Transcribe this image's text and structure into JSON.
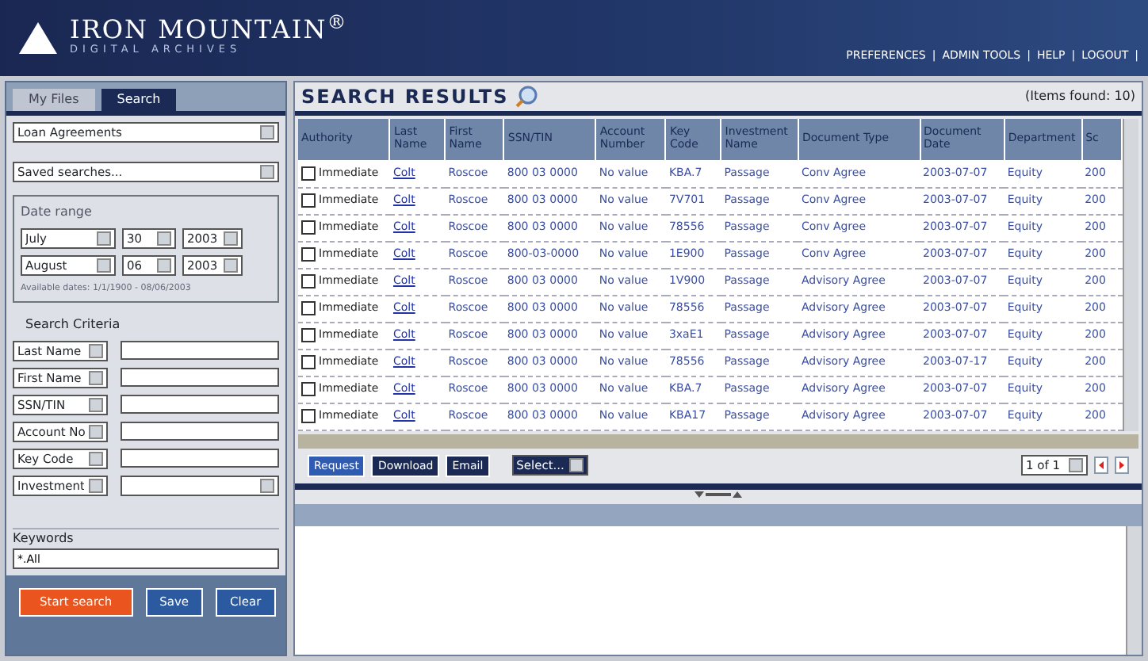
{
  "header": {
    "logo_name": "IRON MOUNTAIN",
    "logo_mark": "®",
    "logo_sub": "DIGITAL ARCHIVES",
    "links": [
      "PREFERENCES",
      "ADMIN TOOLS",
      "HELP",
      "LOGOUT"
    ],
    "separator": "|"
  },
  "sidebar": {
    "tabs": [
      {
        "label": "My Files",
        "selected": false
      },
      {
        "label": "Search",
        "selected": true
      }
    ],
    "category": "Loan Agreements",
    "saved_searches": "Saved searches...",
    "date_range": {
      "legend": "Date range",
      "from": [
        "July",
        "30",
        "2003"
      ],
      "to": [
        "August",
        "06",
        "2003"
      ],
      "note": "Available dates: 1/1/1900 - 08/06/2003"
    },
    "criteria_title": "Search Criteria",
    "criteria": [
      {
        "field": "Last Name",
        "kind": "text"
      },
      {
        "field": "First Name",
        "kind": "text"
      },
      {
        "field": "SSN/TIN",
        "kind": "text"
      },
      {
        "field": "Account No",
        "kind": "text"
      },
      {
        "field": "Key Code",
        "kind": "text"
      },
      {
        "field": "Investment",
        "kind": "select"
      }
    ],
    "keywords_label": "Keywords",
    "keywords": "*.All",
    "buttons": [
      {
        "label": "Start search",
        "kind": "primary"
      },
      {
        "label": "Save",
        "kind": "secondary"
      },
      {
        "label": "Clear",
        "kind": "secondary"
      }
    ]
  },
  "results": {
    "title": "SEARCH RESULTS",
    "count": "(Items found: 10)",
    "columns": [
      "Authority",
      "Last Name",
      "First Name",
      "SSN/TIN",
      "Account Number",
      "Key Code",
      "Investment Name",
      "Document Type",
      "Document Date",
      "Department",
      "Sc"
    ],
    "rows": [
      {
        "checked": false,
        "cells": [
          "Immediate",
          "Colt",
          "Roscoe",
          "800 03 0000",
          "No value",
          "KBA.7",
          "Passage",
          "Conv Agree",
          "2003-07-07",
          "Equity",
          "200"
        ]
      },
      {
        "checked": false,
        "cells": [
          "Immediate",
          "Colt",
          "Roscoe",
          "800 03 0000",
          "No value",
          "7V701",
          "Passage",
          "Conv Agree",
          "2003-07-07",
          "Equity",
          "200"
        ]
      },
      {
        "checked": false,
        "cells": [
          "Immediate",
          "Colt",
          "Roscoe",
          "800 03 0000",
          "No value",
          "78556",
          "Passage",
          "Conv Agree",
          "2003-07-07",
          "Equity",
          "200"
        ]
      },
      {
        "checked": false,
        "cells": [
          "Immediate",
          "Colt",
          "Roscoe",
          "800-03-0000",
          "No value",
          "1E900",
          "Passage",
          "Conv Agree",
          "2003-07-07",
          "Equity",
          "200"
        ]
      },
      {
        "checked": false,
        "cells": [
          "Immediate",
          "Colt",
          "Roscoe",
          "800 03 0000",
          "No value",
          "1V900",
          "Passage",
          "Advisory Agree",
          "2003-07-07",
          "Equity",
          "200"
        ]
      },
      {
        "checked": false,
        "cells": [
          "Immediate",
          "Colt",
          "Roscoe",
          "800 03 0000",
          "No value",
          "78556",
          "Passage",
          "Advisory Agree",
          "2003-07-07",
          "Equity",
          "200"
        ]
      },
      {
        "checked": false,
        "cells": [
          "Immediate",
          "Colt",
          "Roscoe",
          "800 03 0000",
          "No value",
          "3xaE1",
          "Passage",
          "Advisory Agree",
          "2003-07-07",
          "Equity",
          "200"
        ]
      },
      {
        "checked": false,
        "cells": [
          "Immediate",
          "Colt",
          "Roscoe",
          "800 03 0000",
          "No value",
          "78556",
          "Passage",
          "Advisory Agree",
          "2003-07-17",
          "Equity",
          "200"
        ]
      },
      {
        "checked": false,
        "cells": [
          "Immediate",
          "Colt",
          "Roscoe",
          "800 03 0000",
          "No value",
          "KBA.7",
          "Passage",
          "Advisory Agree",
          "2003-07-07",
          "Equity",
          "200"
        ]
      },
      {
        "checked": false,
        "cells": [
          "Immediate",
          "Colt",
          "Roscoe",
          "800 03 0000",
          "No value",
          "KBA17",
          "Passage",
          "Advisory Agree",
          "2003-07-07",
          "Equity",
          "200"
        ]
      }
    ],
    "actions": [
      "Request",
      "Download",
      "Email"
    ],
    "action_select": "Select...",
    "page": "1 of 1"
  }
}
